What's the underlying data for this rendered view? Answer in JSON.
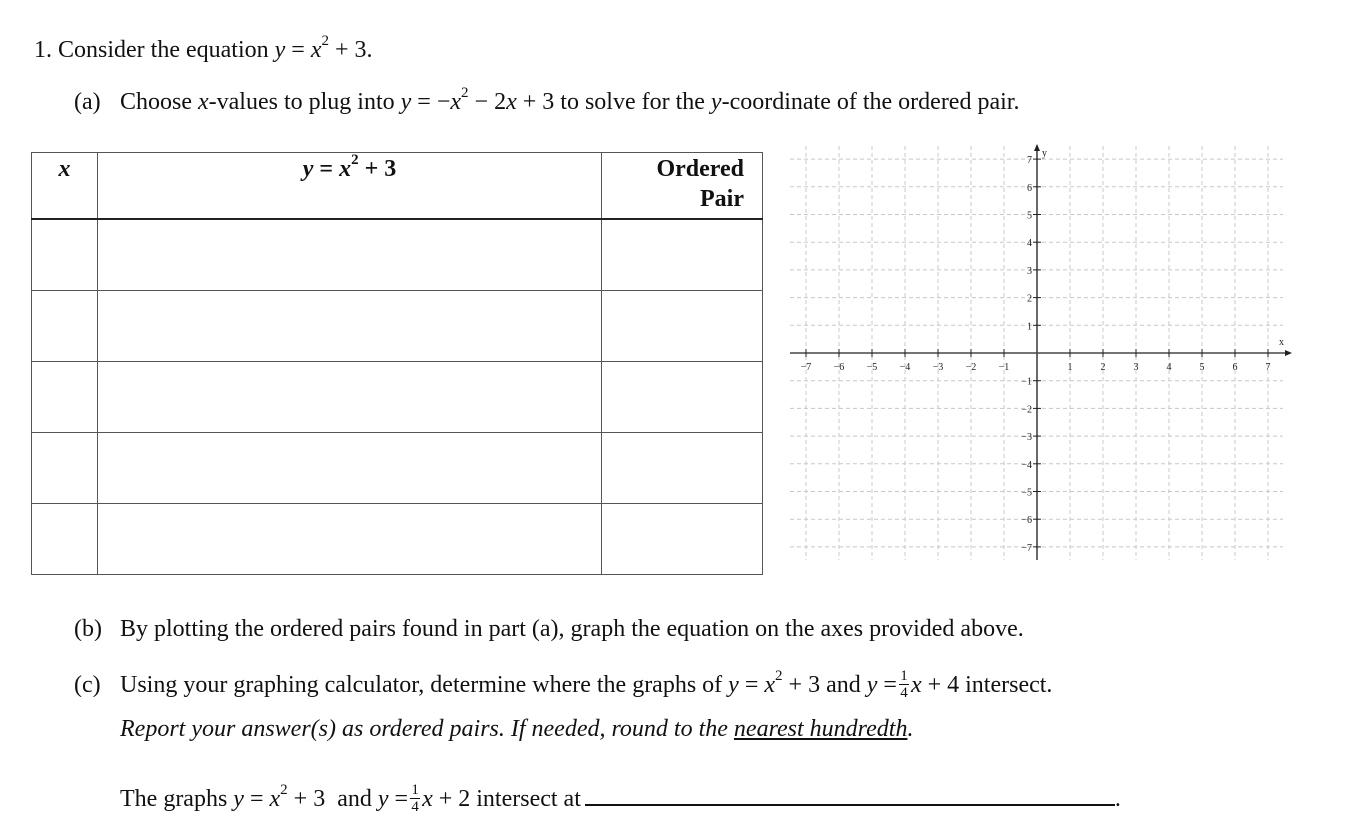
{
  "question": {
    "number": "1.",
    "intro_text": "Consider the equation",
    "equation_main": {
      "lhs": "y",
      "var": "x",
      "exp": "2",
      "rest": "+ 3."
    },
    "part_a": {
      "label": "(a)",
      "text_1": "Choose",
      "var_x": "x",
      "text_2": "-values to plug into",
      "equation": {
        "lhs": "y",
        "sign": "= −",
        "var": "x",
        "exp": "2",
        "rest": " − 2",
        "var2": "x",
        "rest2": " + 3"
      },
      "text_3": "to solve for the",
      "var_y": "y",
      "text_4": "-coordinate of the ordered pair."
    },
    "part_b": {
      "label": "(b)",
      "text": "By plotting the ordered pairs found in part (a), graph the equation on the axes provided above."
    },
    "part_c": {
      "label": "(c)",
      "text_1": "Using your graphing calculator, determine where the graphs of",
      "eq1": {
        "lhs": "y",
        "var": "x",
        "exp": "2",
        "rest": "+ 3"
      },
      "and": "and",
      "eq2": {
        "lhs": "y",
        "num": "1",
        "den": "4",
        "var": "x",
        "rest": "+ 4"
      },
      "text_2": "intersect.",
      "instruction_1": "Report your answer(s) as ordered pairs.  If needed, round to the",
      "instruction_underlined": "nearest hundredth",
      "instruction_end": ".",
      "answer_prefix": "The graphs",
      "answer_eq1": {
        "lhs": "y",
        "var": "x",
        "exp": "2",
        "rest": "+ 3"
      },
      "answer_and": "and",
      "answer_eq2": {
        "lhs": "y",
        "num": "1",
        "den": "4",
        "var": "x",
        "rest": "+ 2"
      },
      "answer_suffix": "intersect at",
      "answer_value": "",
      "answer_end": "."
    }
  },
  "table": {
    "headers": {
      "x": "x",
      "equation": {
        "lhs": "y",
        "var": "x",
        "exp": "2",
        "rest": "+ 3"
      },
      "ordered_pair_line1": "Ordered",
      "ordered_pair_line2": "Pair"
    },
    "rows": [
      {
        "x": "",
        "y": "",
        "pair": ""
      },
      {
        "x": "",
        "y": "",
        "pair": ""
      },
      {
        "x": "",
        "y": "",
        "pair": ""
      },
      {
        "x": "",
        "y": "",
        "pair": ""
      },
      {
        "x": "",
        "y": "",
        "pair": ""
      }
    ]
  },
  "chart_data": {
    "type": "scatter",
    "title": "",
    "xlabel": "x",
    "ylabel": "y",
    "xlim": [
      -7,
      7
    ],
    "ylim": [
      -7,
      7
    ],
    "x_ticks": [
      -7,
      -6,
      -5,
      -4,
      -3,
      -2,
      -1,
      1,
      2,
      3,
      4,
      5,
      6,
      7
    ],
    "y_ticks": [
      -7,
      -6,
      -5,
      -4,
      -3,
      -2,
      -1,
      1,
      2,
      3,
      4,
      5,
      6,
      7
    ],
    "grid": "dashed, every 1 unit",
    "points": []
  }
}
